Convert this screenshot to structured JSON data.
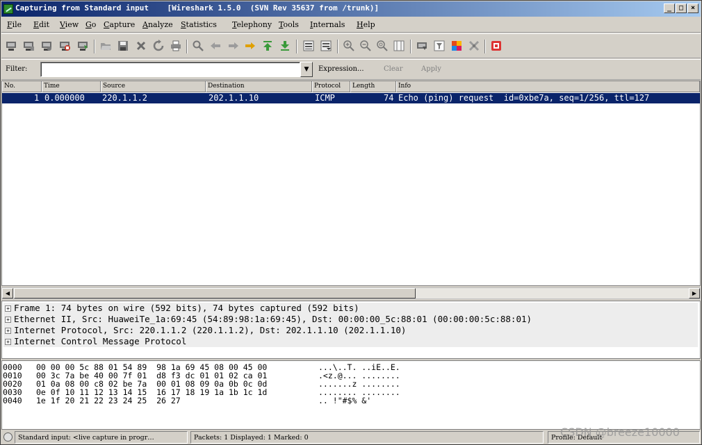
{
  "window": {
    "title": "Capturing from Standard input    [Wireshark 1.5.0  (SVN Rev 35637 from /trunk)]",
    "min_label": "_",
    "max_label": "□",
    "close_label": "×"
  },
  "menu": [
    "File",
    "Edit",
    "View",
    "Go",
    "Capture",
    "Analyze",
    "Statistics",
    "Telephony",
    "Tools",
    "Internals",
    "Help"
  ],
  "toolbar_icons": [
    "interface-list-icon",
    "capture-options-icon",
    "start-capture-icon",
    "stop-capture-icon",
    "restart-capture-icon",
    "open-file-icon",
    "save-file-icon",
    "close-file-icon",
    "reload-icon",
    "print-icon",
    "find-packet-icon",
    "go-back-icon",
    "go-forward-icon",
    "go-to-packet-icon",
    "go-first-icon",
    "go-last-icon",
    "colorize-icon",
    "auto-scroll-icon",
    "zoom-in-icon",
    "zoom-out-icon",
    "zoom-normal-icon",
    "resize-columns-icon",
    "capture-filters-icon",
    "display-filters-icon",
    "coloring-rules-icon",
    "preferences-icon",
    "help-icon"
  ],
  "filter": {
    "label": "Filter:",
    "value": "",
    "expression": "Expression...",
    "clear": "Clear",
    "apply": "Apply"
  },
  "packet_list": {
    "columns": [
      "No.",
      "Time",
      "Source",
      "Destination",
      "Protocol",
      "Length",
      "Info"
    ],
    "rows": [
      {
        "no": "1",
        "time": "0.000000",
        "source": "220.1.1.2",
        "destination": "202.1.1.10",
        "protocol": "ICMP",
        "length": "74",
        "info": "Echo (ping) request  id=0xbe7a, seq=1/256, ttl=127"
      }
    ]
  },
  "details": [
    "Frame 1: 74 bytes on wire (592 bits), 74 bytes captured (592 bits)",
    "Ethernet II, Src: HuaweiTe_1a:69:45 (54:89:98:1a:69:45), Dst: 00:00:00_5c:88:01 (00:00:00:5c:88:01)",
    "Internet Protocol, Src: 220.1.1.2 (220.1.1.2), Dst: 202.1.1.10 (202.1.1.10)",
    "Internet Control Message Protocol"
  ],
  "hex": [
    {
      "offset": "0000",
      "bytes": "00 00 00 5c 88 01 54 89  98 1a 69 45 08 00 45 00",
      "ascii": "...\\..T. ..iE..E."
    },
    {
      "offset": "0010",
      "bytes": "00 3c 7a be 40 00 7f 01  d8 f3 dc 01 01 02 ca 01",
      "ascii": ".<z.@... ........"
    },
    {
      "offset": "0020",
      "bytes": "01 0a 08 00 c8 02 be 7a  00 01 08 09 0a 0b 0c 0d",
      "ascii": ".......z ........"
    },
    {
      "offset": "0030",
      "bytes": "0e 0f 10 11 12 13 14 15  16 17 18 19 1a 1b 1c 1d",
      "ascii": "........ ........"
    },
    {
      "offset": "0040",
      "bytes": "1e 1f 20 21 22 23 24 25  26 27",
      "ascii": ".. !\"#$% &'"
    }
  ],
  "status": {
    "capture": "Standard input: <live capture in progr…",
    "packets": "Packets: 1 Displayed: 1 Marked: 0",
    "profile": "Profile: Default"
  },
  "watermark": "CSDN @breeze10000"
}
